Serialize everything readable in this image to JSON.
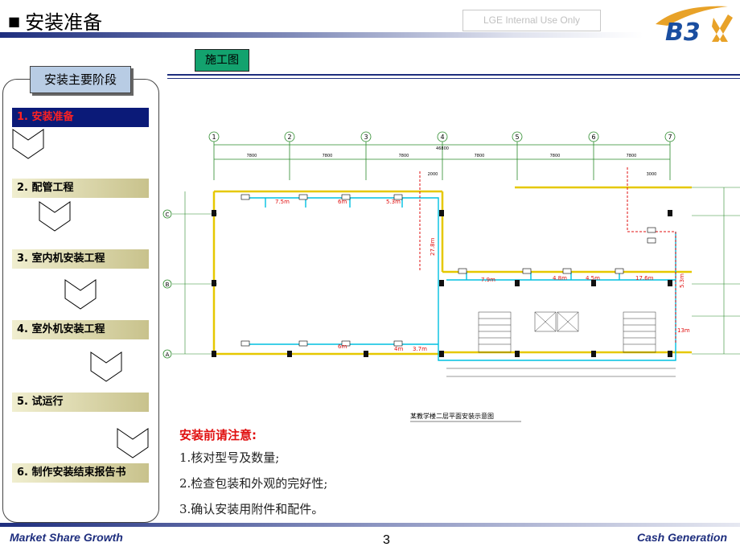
{
  "header": {
    "bullet": "■",
    "title": "安装准备",
    "internal_badge": "LGE Internal Use Only",
    "logo_text": "B3X",
    "bar_color": "#1e2e7e"
  },
  "section_tag": "施工图",
  "stages": {
    "header": "安装主要阶段",
    "items": [
      {
        "label": "1. 安装准备",
        "active": true
      },
      {
        "label": "2. 配管工程",
        "active": false
      },
      {
        "label": "3. 室内机安装工程",
        "active": false
      },
      {
        "label": "4. 室外机安装工程",
        "active": false
      },
      {
        "label": "5. 试运行",
        "active": false
      },
      {
        "label": "6. 制作安装结束报告书",
        "active": false
      }
    ],
    "active_bg": "#0b1a78",
    "active_text": "#ff2222"
  },
  "drawing": {
    "caption": "某教学楼二层平面安装示意图",
    "column_axes": [
      "1",
      "2",
      "3",
      "4",
      "5",
      "6",
      "7"
    ],
    "row_axes": [
      "C",
      "B",
      "A"
    ],
    "total_dimension": "46800",
    "bay_dimensions": [
      "7800",
      "7800",
      "7800",
      "7800",
      "7800",
      "7800"
    ],
    "offsets": [
      "2000",
      "3000"
    ],
    "run_lengths": [
      "7.5m",
      "6m",
      "5.3m",
      "7.9m",
      "4.8m",
      "4.5m",
      "17.6m",
      "6m",
      "4m",
      "3.7m",
      "27.8m",
      "5.3m",
      "13m"
    ]
  },
  "notes": {
    "title": "安装前请注意:",
    "items": [
      "1.核对型号及数量;",
      "2.检查包装和外观的完好性;",
      "3.确认安装用附件和配件。"
    ]
  },
  "footer": {
    "left": "Market Share Growth",
    "page": "3",
    "right": "Cash Generation"
  }
}
